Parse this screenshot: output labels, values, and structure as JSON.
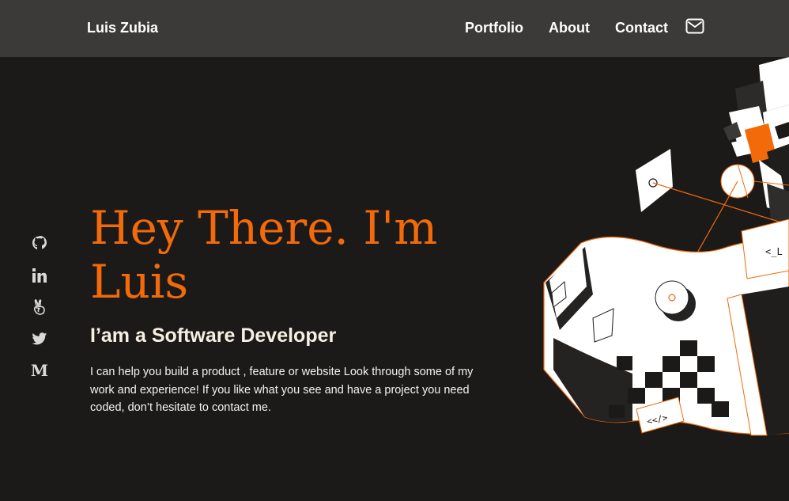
{
  "header": {
    "brand": "Luis Zubia",
    "nav": [
      "Portfolio",
      "About",
      "Contact"
    ],
    "mail_icon": "mail-icon"
  },
  "social": [
    {
      "name": "github-icon"
    },
    {
      "name": "linkedin-icon"
    },
    {
      "name": "angellist-icon"
    },
    {
      "name": "twitter-icon"
    },
    {
      "name": "medium-icon",
      "glyph": "M"
    }
  ],
  "hero": {
    "title_line1": "Hey There. I'm",
    "title_line2": "Luis",
    "subtitle": "I’am a Software Developer",
    "description": "I can help you build a product , feature or website Look through some of my work and experience! If you like what you see and have a project you need coded, don’t hesitate to contact me."
  },
  "illustration": {
    "code_tag_1": "<_L",
    "code_tag_2": "<</>"
  },
  "colors": {
    "accent": "#f26a0a",
    "background": "#1c1a19",
    "navbar": "#3b3a39"
  }
}
